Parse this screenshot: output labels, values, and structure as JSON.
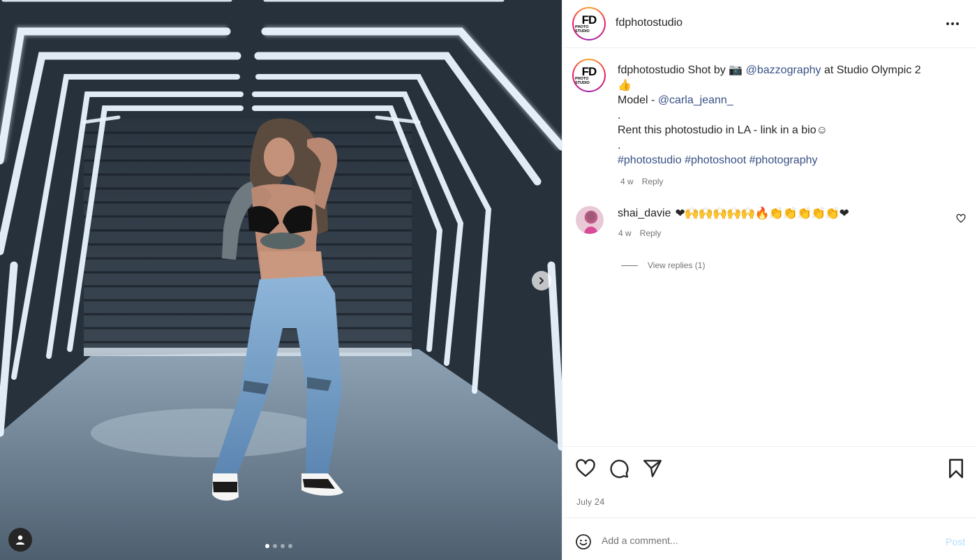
{
  "post": {
    "username": "fdphotostudio",
    "avatar_logo": "FD",
    "avatar_sub": "PHOTO STUDIO"
  },
  "caption": {
    "username": "fdphotostudio",
    "text_before": "Shot by",
    "camera_icon": "📷",
    "mention_photographer": "@bazzography",
    "text_after": "at Studio Olympic 2",
    "thumbs_icon": "👍",
    "model_prefix": "Model -",
    "mention_model": "@carla_jeann_",
    "dot1": ".",
    "rent_line": "Rent this photostudio in LA - link in a bio☺",
    "dot2": ".",
    "hashtags": [
      "#photostudio",
      "#photoshoot",
      "#photography"
    ],
    "time": "4 w",
    "reply": "Reply"
  },
  "comment": {
    "username": "shai_davie",
    "emojis": "❤🙌🙌🙌🙌🙌🔥👏👏👏👏👏❤",
    "time": "4 w",
    "reply": "Reply",
    "view_replies": "View replies (1)"
  },
  "actions": {
    "date_month": "July",
    "date_day": "24"
  },
  "composer": {
    "placeholder": "Add a comment...",
    "post_label": "Post"
  },
  "carousel": {
    "total_slides": 4,
    "active_slide": 1
  },
  "colors": {
    "link": "#385185",
    "muted": "#737373",
    "post_disabled": "#b2dffc",
    "like_red": "#ed4956"
  }
}
